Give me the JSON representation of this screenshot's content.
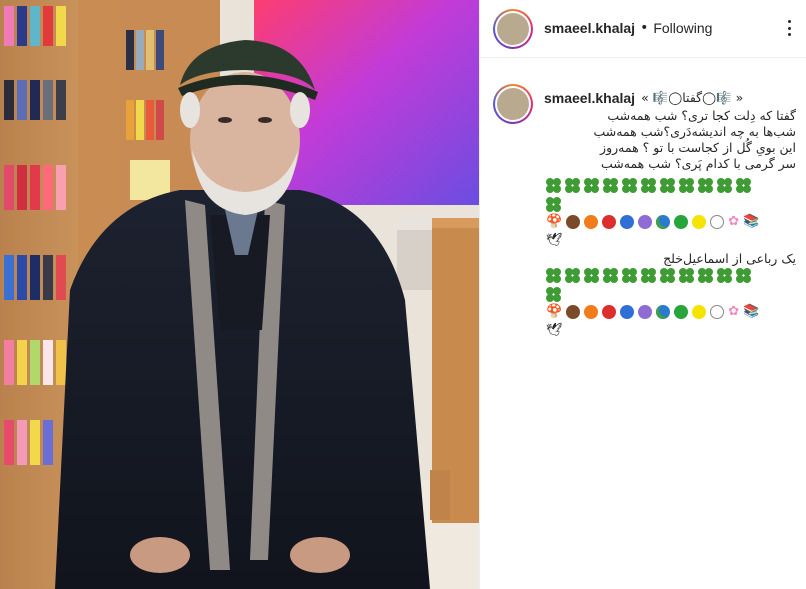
{
  "post": {
    "username": "smaeel.khalaj",
    "separator": "•",
    "follow_status": "Following"
  },
  "caption": {
    "username": "smaeel.khalaj",
    "title_line": "« 🎼◯گفتا◯🎼 »",
    "lines": [
      "گفتا که دِلت کجا تری؟ شب همه‌شب",
      "شب‌ها به چه اندیشه‌دَری؟شب همه‌شب",
      "این بویِ گُل از کجاست با تو ؟ همه‌روز",
      "سر گرمی با کدام پَری؟ شب همه‌شب"
    ],
    "attribution": "یک رباعی از اسماعیل‌خلج"
  },
  "icons": {
    "more": "more-options-icon",
    "clover": "four-leaf-clover-icon",
    "mushroom": "mushroom-icon",
    "flower": "cherry-blossom-icon",
    "books": "books-icon",
    "dove": "dove-icon"
  },
  "colors": {
    "clover": "#3f9c35",
    "circles": [
      "#7b4a2a",
      "#f07c1c",
      "#dd2e2e",
      "#2f6fd6",
      "#8f6bd6",
      "#27a43a",
      "#f5e400",
      "#ffffff"
    ],
    "globe": "#2a7bd0"
  }
}
